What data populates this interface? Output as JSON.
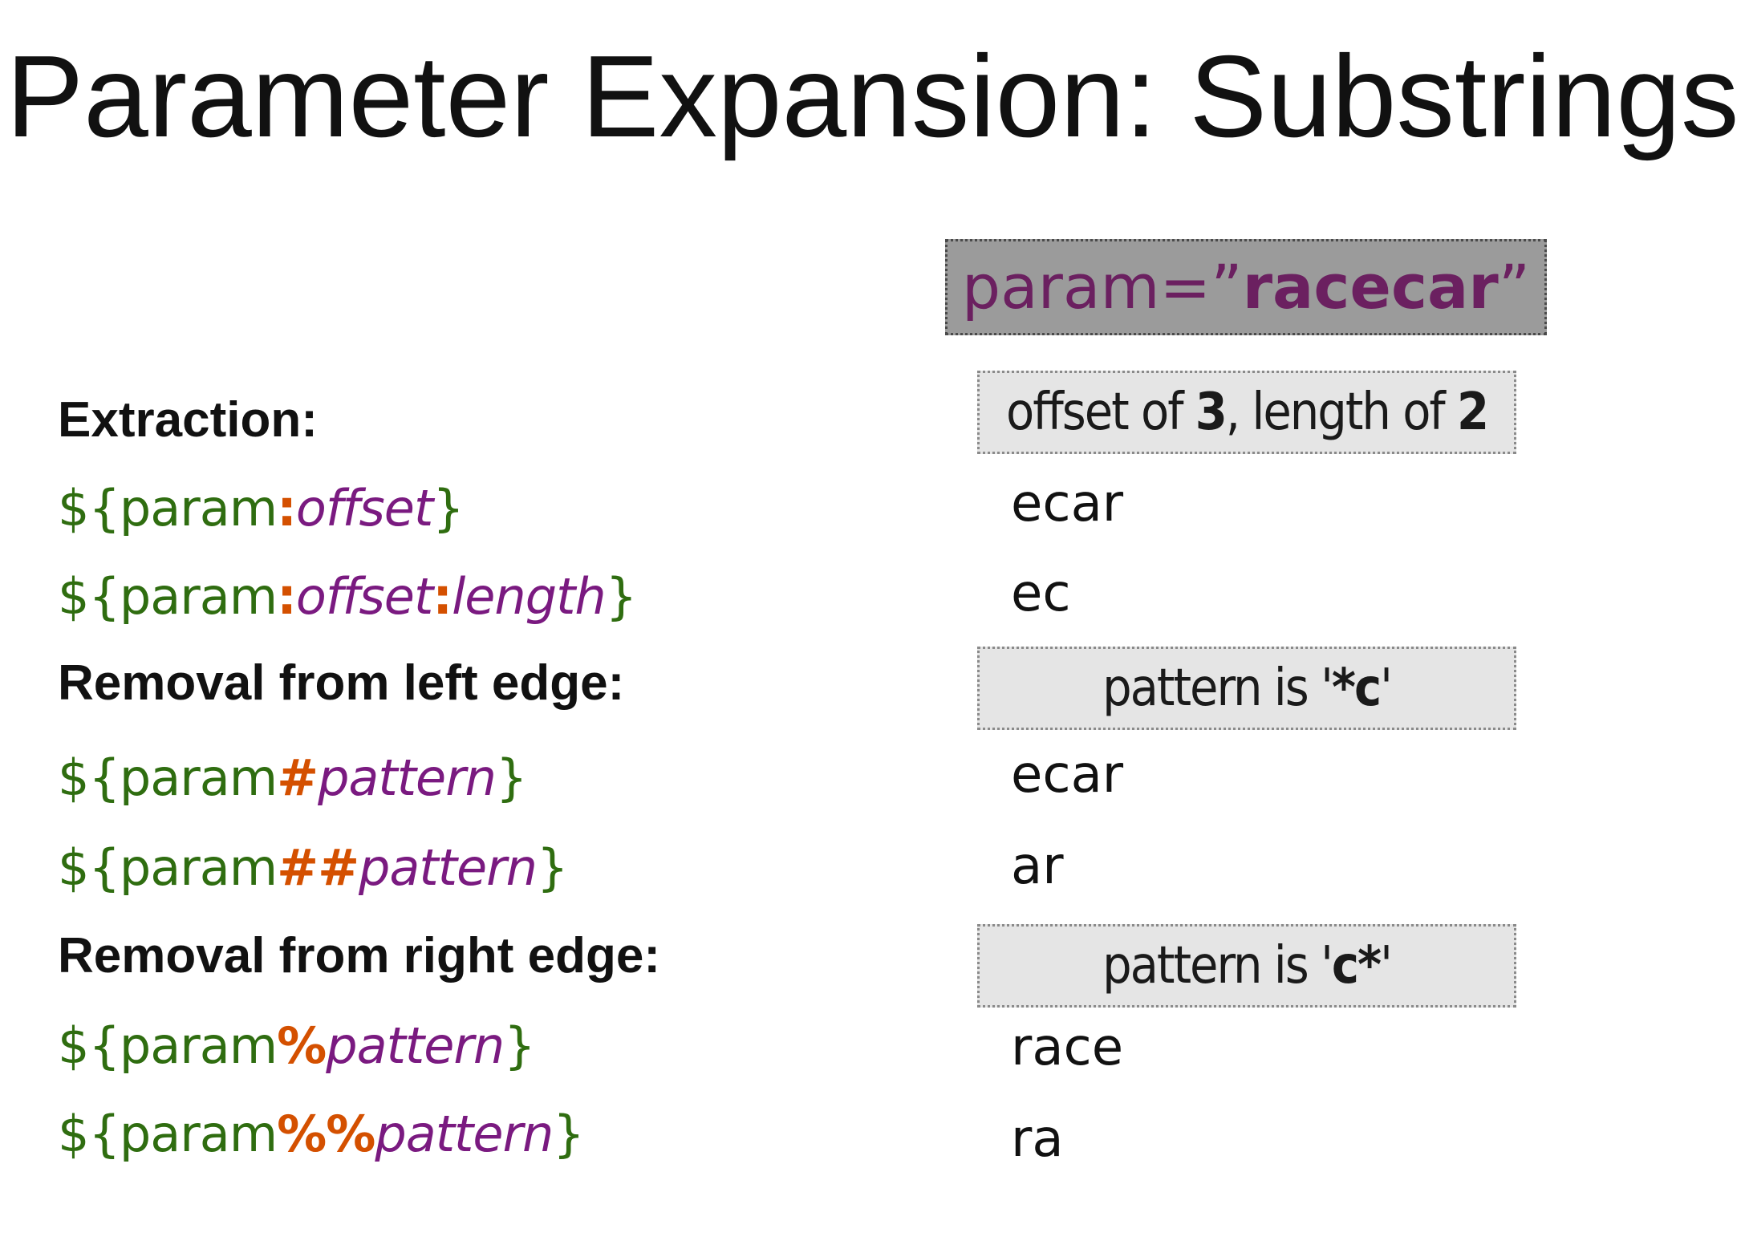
{
  "title": "Parameter Expansion: Substrings",
  "param_box": {
    "prefix": "param=”",
    "value": "racecar",
    "suffix": "”"
  },
  "sections": [
    {
      "heading": "Extraction:",
      "note": {
        "parts": [
          "offset of ",
          "3",
          ", length of ",
          "2"
        ]
      },
      "rows": [
        {
          "expr": {
            "open": "${param",
            "op": ":",
            "arg1": "offset",
            "op2": "",
            "arg2": "",
            "close": "}"
          },
          "result": "ecar"
        },
        {
          "expr": {
            "open": "${param",
            "op": ":",
            "arg1": "offset",
            "op2": ":",
            "arg2": "length",
            "close": "}"
          },
          "result": "ec"
        }
      ]
    },
    {
      "heading": "Removal from left edge:",
      "note": {
        "parts": [
          "pattern is '",
          "*c",
          "'"
        ]
      },
      "rows": [
        {
          "expr": {
            "open": "${param",
            "op": "#",
            "arg1": "pattern",
            "close": "}"
          },
          "result": "ecar"
        },
        {
          "expr": {
            "open": "${param",
            "op": "##",
            "arg1": "pattern",
            "close": "}"
          },
          "result": "ar"
        }
      ]
    },
    {
      "heading": "Removal from right edge:",
      "note": {
        "parts": [
          "pattern is '",
          "c*",
          "'"
        ]
      },
      "rows": [
        {
          "expr": {
            "open": "${param",
            "op": "%",
            "arg1": "pattern",
            "close": "}"
          },
          "result": "race"
        },
        {
          "expr": {
            "open": "${param",
            "op": "%%",
            "arg1": "pattern",
            "close": "}"
          },
          "result": "ra"
        }
      ]
    }
  ]
}
